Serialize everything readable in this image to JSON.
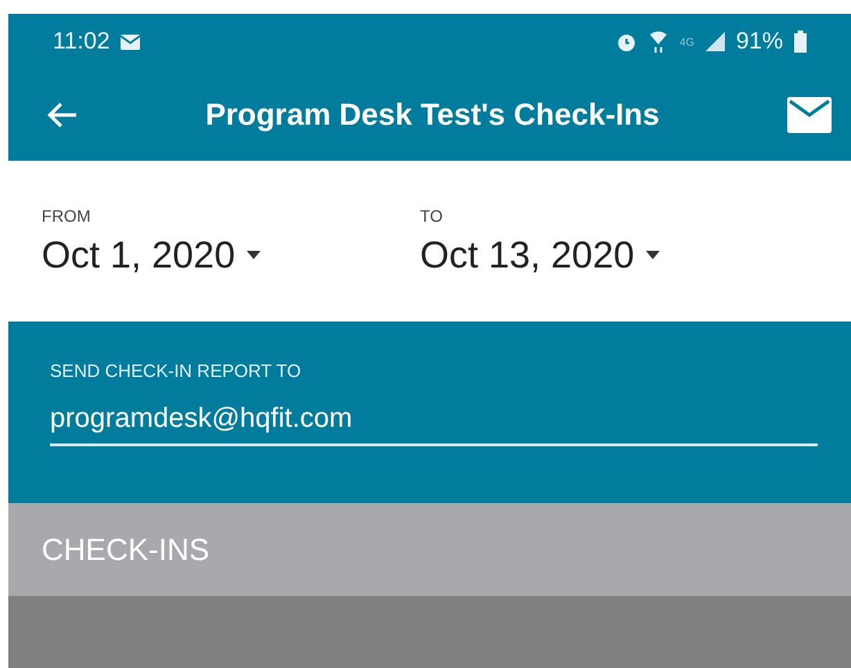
{
  "status_bar": {
    "time": "11:02",
    "network": "4G",
    "battery": "91%"
  },
  "toolbar": {
    "title": "Program Desk Test's Check-Ins"
  },
  "date_range": [
    {
      "label": "FROM",
      "value": "Oct 1, 2020"
    },
    {
      "label": "TO",
      "value": "Oct 13, 2020"
    }
  ],
  "report": {
    "label": "SEND CHECK-IN REPORT TO",
    "value": "programdesk@hqfit.com"
  },
  "section": {
    "title": "CHECK-INS"
  }
}
